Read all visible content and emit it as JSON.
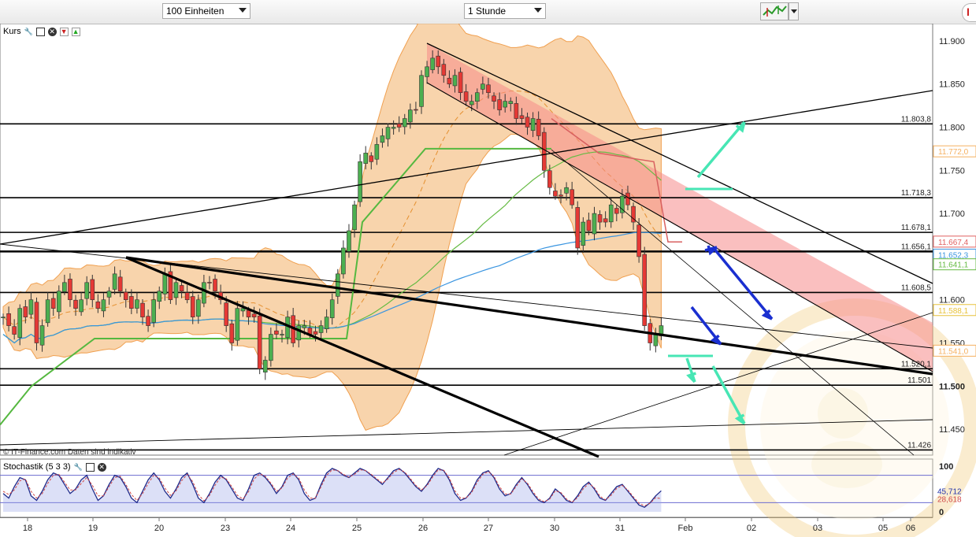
{
  "toolbar": {
    "units_value": "100 Einheiten",
    "interval_value": "1 Stunde"
  },
  "main_panel": {
    "title": "Kurs"
  },
  "stoch_panel": {
    "title": "Stochastik (5 3 3)"
  },
  "source_note": "© IT-Finance.com  Daten sind indikativ",
  "colors": {
    "up_candle": "#4caf50",
    "down_candle": "#e53935",
    "bollinger": "#f6c690",
    "sma_green": "#66bb44",
    "sma_blue": "#3a95e0",
    "hline": "#000000",
    "arrow_teal": "#47e6b4",
    "arrow_blue": "#1a2fd0",
    "channel": "#f68a8a"
  },
  "chart_data": {
    "type": "candlestick",
    "x_ticks": [
      "18",
      "19",
      "20",
      "23",
      "24",
      "25",
      "26",
      "27",
      "30",
      "31",
      "Feb",
      "02",
      "03",
      "05",
      "06"
    ],
    "y_ticks": [
      "11.900",
      "11.850",
      "11.800",
      "11.750",
      "11.700",
      "11.650",
      "11.600",
      "11.550",
      "11.500",
      "11.450"
    ],
    "ylim": [
      11.42,
      11.92
    ],
    "horizontal_levels": [
      {
        "value": 11.8038,
        "label": "11.803,8"
      },
      {
        "value": 11.7183,
        "label": "11.718,3"
      },
      {
        "value": 11.6781,
        "label": "11.678,1"
      },
      {
        "value": 11.656,
        "label": "11.656,1"
      },
      {
        "value": 11.6085,
        "label": "11.608,5"
      },
      {
        "value": 11.5201,
        "label": "11.520,1"
      },
      {
        "value": 11.501,
        "label": "11.501"
      },
      {
        "value": 11.426,
        "label": "11.426"
      }
    ],
    "value_badges": [
      {
        "value": 11.772,
        "label": "11.772,0",
        "color": "#f5b060"
      },
      {
        "value": 11.6674,
        "label": "11.667,4",
        "color": "#e06060"
      },
      {
        "value": 11.6523,
        "label": "11.652,3",
        "color": "#3a95e0"
      },
      {
        "value": 11.6411,
        "label": "11.641,1",
        "color": "#66bb44"
      },
      {
        "value": 11.5881,
        "label": "11.588,1",
        "color": "#e8c23a"
      },
      {
        "value": 11.541,
        "label": "11.541,0",
        "color": "#f5b060"
      }
    ],
    "closes": [
      11.58,
      11.57,
      11.56,
      11.59,
      11.58,
      11.6,
      11.55,
      11.57,
      11.6,
      11.59,
      11.61,
      11.62,
      11.6,
      11.59,
      11.6,
      11.62,
      11.6,
      11.59,
      11.6,
      11.61,
      11.63,
      11.61,
      11.6,
      11.59,
      11.6,
      11.58,
      11.57,
      11.6,
      11.61,
      11.63,
      11.6,
      11.62,
      11.61,
      11.6,
      11.58,
      11.6,
      11.62,
      11.62,
      11.61,
      11.6,
      11.57,
      11.55,
      11.59,
      11.59,
      11.58,
      11.58,
      11.52,
      11.53,
      11.56,
      11.56,
      11.56,
      11.58,
      11.55,
      11.57,
      11.57,
      11.56,
      11.56,
      11.57,
      11.58,
      11.6,
      11.63,
      11.66,
      11.68,
      11.71,
      11.76,
      11.77,
      11.76,
      11.78,
      11.79,
      11.8,
      11.8,
      11.8,
      11.81,
      11.82,
      11.82,
      11.86,
      11.87,
      11.88,
      11.87,
      11.86,
      11.85,
      11.86,
      11.84,
      11.83,
      11.83,
      11.84,
      11.85,
      11.84,
      11.83,
      11.82,
      11.83,
      11.83,
      11.81,
      11.81,
      11.8,
      11.81,
      11.79,
      11.75,
      11.73,
      11.72,
      11.72,
      11.73,
      11.71,
      11.66,
      11.69,
      11.68,
      11.7,
      11.69,
      11.69,
      11.71,
      11.7,
      11.72,
      11.71,
      11.69,
      11.65,
      11.57,
      11.55,
      11.56,
      11.57
    ],
    "stochastic": {
      "y_ticks": [
        "100",
        "0"
      ],
      "levels": [
        {
          "value": 80
        },
        {
          "value": 20
        }
      ],
      "value_badges": [
        {
          "value": 45.712,
          "label": "45,712",
          "color": "#2233aa"
        },
        {
          "value": 28.618,
          "label": "28,618",
          "color": "#d04a4a"
        }
      ],
      "k": [
        40,
        30,
        55,
        75,
        70,
        35,
        25,
        45,
        70,
        85,
        80,
        60,
        40,
        50,
        70,
        80,
        50,
        25,
        35,
        60,
        80,
        75,
        55,
        30,
        20,
        45,
        70,
        85,
        70,
        45,
        30,
        50,
        75,
        85,
        60,
        30,
        20,
        40,
        65,
        80,
        70,
        50,
        30,
        25,
        50,
        80,
        85,
        75,
        60,
        40,
        55,
        80,
        85,
        70,
        40,
        25,
        30,
        60,
        85,
        95,
        90,
        80,
        75,
        85,
        95,
        90,
        80,
        70,
        60,
        75,
        90,
        95,
        85,
        70,
        55,
        45,
        60,
        80,
        95,
        90,
        70,
        40,
        25,
        30,
        45,
        70,
        85,
        90,
        75,
        50,
        35,
        40,
        60,
        75,
        60,
        40,
        25,
        20,
        30,
        50,
        40,
        25,
        20,
        35,
        55,
        65,
        50,
        30,
        25,
        40,
        55,
        60,
        45,
        30,
        15,
        10,
        20,
        35,
        46
      ],
      "d": [
        45,
        38,
        48,
        68,
        72,
        45,
        30,
        40,
        62,
        80,
        82,
        65,
        48,
        48,
        62,
        75,
        58,
        35,
        35,
        55,
        75,
        78,
        60,
        38,
        25,
        40,
        62,
        80,
        74,
        52,
        36,
        46,
        68,
        82,
        66,
        38,
        24,
        36,
        58,
        76,
        72,
        55,
        36,
        28,
        44,
        72,
        83,
        78,
        63,
        45,
        52,
        74,
        83,
        74,
        48,
        30,
        30,
        55,
        80,
        92,
        90,
        82,
        76,
        82,
        92,
        90,
        82,
        72,
        63,
        72,
        86,
        93,
        87,
        73,
        58,
        48,
        57,
        76,
        92,
        91,
        74,
        46,
        30,
        30,
        42,
        65,
        82,
        88,
        78,
        55,
        39,
        39,
        56,
        72,
        63,
        44,
        28,
        22,
        28,
        46,
        42,
        28,
        21,
        31,
        50,
        62,
        53,
        34,
        26,
        36,
        51,
        58,
        48,
        33,
        19,
        13,
        19,
        31,
        28.6
      ]
    }
  }
}
